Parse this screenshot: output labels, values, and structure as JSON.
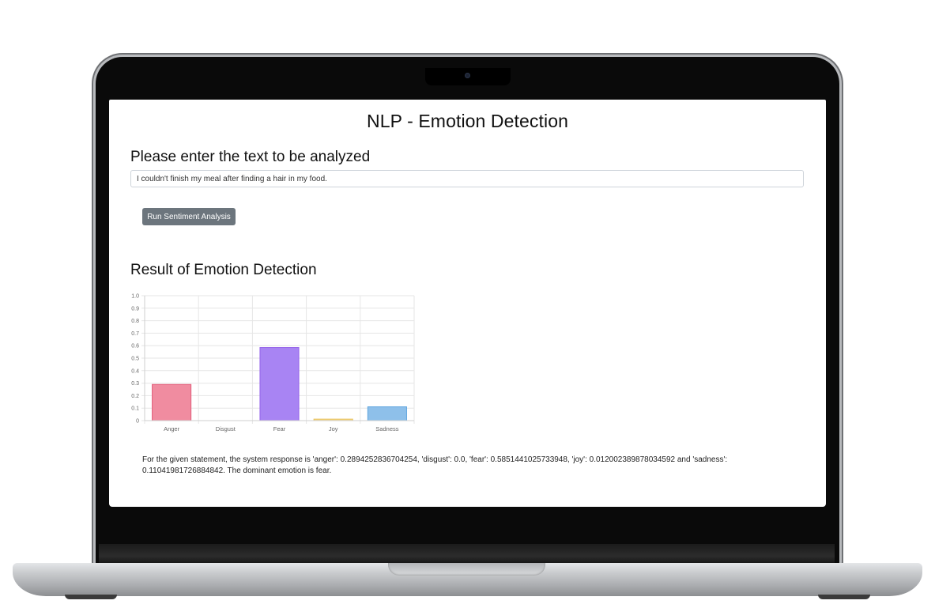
{
  "page": {
    "title": "NLP - Emotion Detection",
    "prompt_heading": "Please enter the text to be analyzed",
    "input_value": "I couldn't finish my meal after finding a hair in my food.",
    "run_button_label": "Run Sentiment Analysis",
    "result_heading": "Result of Emotion Detection",
    "result_text": "For the given statement, the system response is 'anger': 0.2894252836704254, 'disgust': 0.0, 'fear': 0.5851441025733948, 'joy': 0.012002389878034592 and 'sadness': 0.11041981726884842. The dominant emotion is fear."
  },
  "chart_data": {
    "type": "bar",
    "categories": [
      "Anger",
      "Disgust",
      "Fear",
      "Joy",
      "Sadness"
    ],
    "values": [
      0.2894252836704254,
      0.0,
      0.5851441025733948,
      0.012002389878034592,
      0.11041981726884842
    ],
    "colors": [
      "#f08ca0",
      "#ff9f40",
      "#a884f3",
      "#f5d78a",
      "#8ec0ea"
    ],
    "border_colors": [
      "#e25d7a",
      "#ff9f40",
      "#9461ea",
      "#e8c25c",
      "#5ea5de"
    ],
    "ylim": [
      0,
      1.0
    ],
    "yticks": [
      "0",
      "0.1",
      "0.2",
      "0.3",
      "0.4",
      "0.5",
      "0.6",
      "0.7",
      "0.8",
      "0.9",
      "1.0"
    ],
    "grid": true,
    "title": "",
    "xlabel": "",
    "ylabel": ""
  }
}
